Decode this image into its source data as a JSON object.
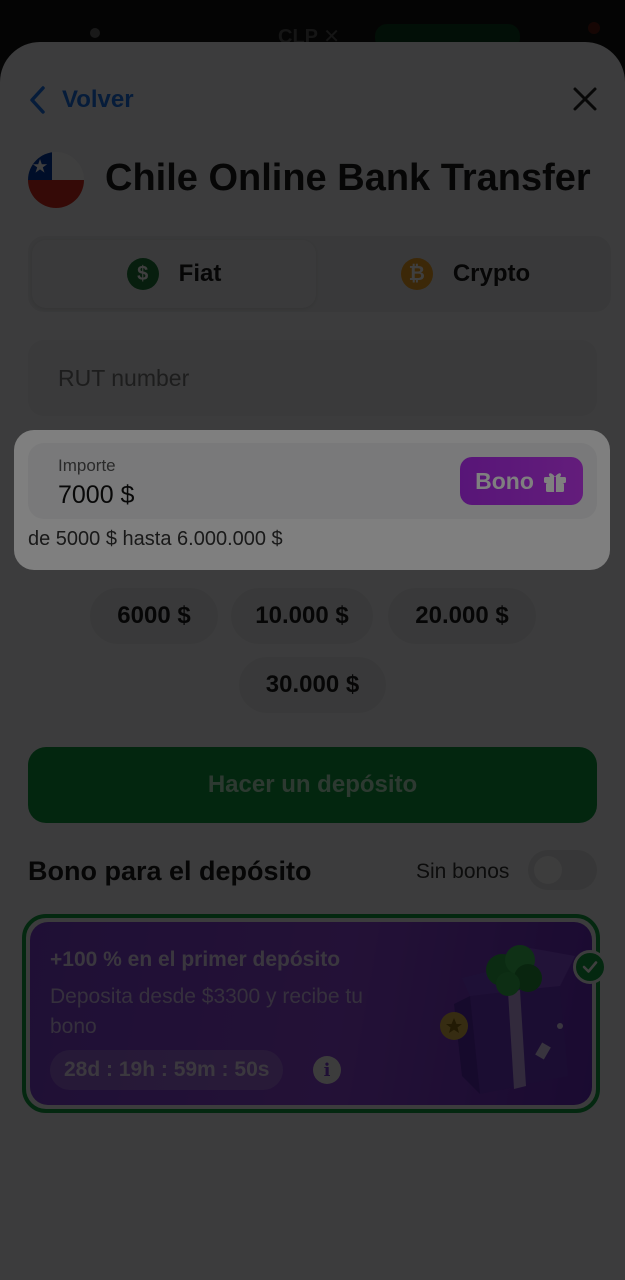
{
  "statusbar": {
    "currency": "CLP ✕"
  },
  "nav": {
    "back_label": "Volver"
  },
  "header": {
    "title": "Chile Online Bank Transfer"
  },
  "tabs": [
    {
      "label": "Fiat",
      "icon": "dollar-icon",
      "color": "#1e7a3a",
      "active": true
    },
    {
      "label": "Crypto",
      "icon": "bitcoin-icon",
      "color": "#f0a020",
      "active": false
    }
  ],
  "rut": {
    "placeholder": "RUT number"
  },
  "amount": {
    "label": "Importe",
    "value": "7000 $",
    "bono_label": "Bono",
    "range": "de 5000 $ hasta 6.000.000 $"
  },
  "quick_amounts": [
    "6000 $",
    "10.000 $",
    "20.000 $",
    "30.000 $"
  ],
  "deposit_button": "Hacer un depósito",
  "bonus": {
    "section_title": "Bono para el depósito",
    "toggle_label": "Sin bonos",
    "toggle_on": false,
    "card": {
      "title": "+100 % en el primer depósito",
      "description": "Deposita desde $3300 y recibe tu bono",
      "timer": "28d : 19h : 59m : 50s",
      "selected": true
    }
  },
  "colors": {
    "accent_blue": "#1a73e8",
    "primary_green": "#0f9a3f",
    "bono_purple": "#b02bf0",
    "card_purple": "#7d3fd6"
  }
}
